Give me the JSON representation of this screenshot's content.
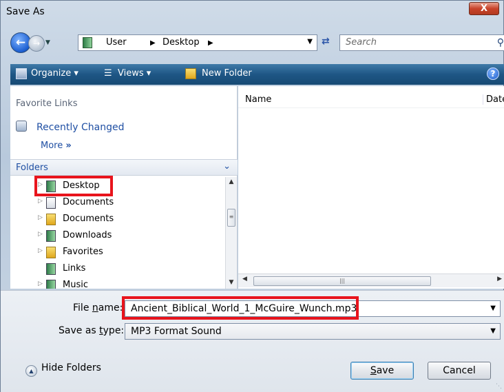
{
  "window": {
    "title": "Save As",
    "close_label": "X"
  },
  "nav": {
    "address": {
      "crumbs": [
        "User",
        "Desktop"
      ]
    },
    "search": {
      "placeholder": "Search"
    }
  },
  "toolbar": {
    "organize": "Organize",
    "views": "Views",
    "new_folder": "New Folder",
    "help": "?"
  },
  "left_pane": {
    "favorite_links_heading": "Favorite Links",
    "favorites": [
      {
        "label": "Recently Changed"
      }
    ],
    "more": "More",
    "folders_heading": "Folders",
    "tree": [
      {
        "label": "Desktop",
        "icon": "green-folder"
      },
      {
        "label": "Documents",
        "icon": "document-folder"
      },
      {
        "label": "Documents",
        "icon": "yellow-folder"
      },
      {
        "label": "Downloads",
        "icon": "green-folder"
      },
      {
        "label": "Favorites",
        "icon": "favorites-folder"
      },
      {
        "label": "Links",
        "icon": "green-folder"
      },
      {
        "label": "Music",
        "icon": "green-folder"
      }
    ]
  },
  "content": {
    "columns": [
      "Name",
      "Date"
    ]
  },
  "form": {
    "file_name_label_pre": "File ",
    "file_name_label_ul": "n",
    "file_name_label_post": "ame:",
    "file_name_value": "Ancient_Biblical_World_1_McGuire_Wunch.mp3",
    "save_type_label_pre": "Save as ",
    "save_type_label_ul": "t",
    "save_type_label_post": "ype:",
    "save_type_value": "MP3 Format Sound"
  },
  "buttons": {
    "hide_folders": "Hide Folders",
    "save_ul": "S",
    "save_rest": "ave",
    "cancel": "Cancel"
  },
  "colors": {
    "highlight": "#e8141c",
    "command_bar": "#1e5685",
    "link": "#1f4fa3"
  }
}
